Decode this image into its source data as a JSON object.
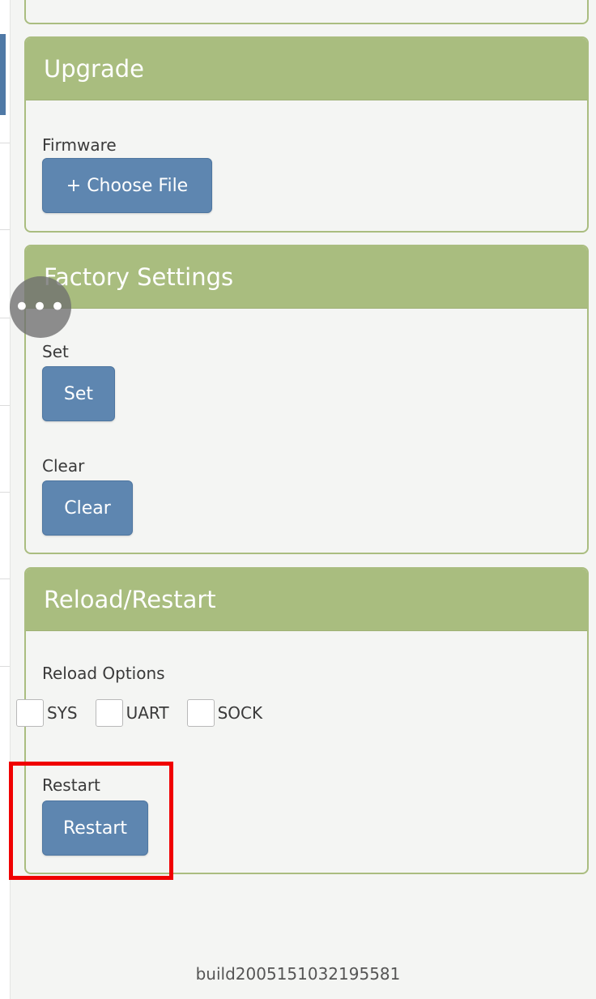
{
  "upgrade": {
    "title": "Upgrade",
    "firmware_label": "Firmware",
    "choose_file_button": "+ Choose File"
  },
  "factory": {
    "title": "Factory Settings",
    "set_label": "Set",
    "set_button": "Set",
    "clear_label": "Clear",
    "clear_button": "Clear"
  },
  "reload": {
    "title": "Reload/Restart",
    "options_label": "Reload Options",
    "options": [
      "SYS",
      "UART",
      "SOCK"
    ],
    "restart_label": "Restart",
    "restart_button": "Restart"
  },
  "floating_button": "•••",
  "build": "build2005151032195581",
  "colors": {
    "header_green": "#a9bd7f",
    "button_blue": "#5e86b0",
    "highlight_red": "#f00000"
  }
}
